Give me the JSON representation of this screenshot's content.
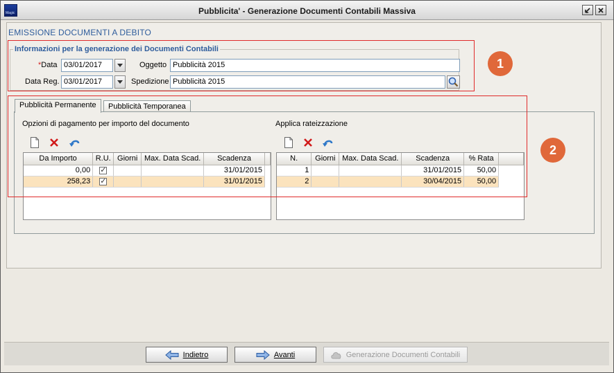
{
  "window": {
    "title": "Pubblicita' - Generazione Documenti Contabili Massiva",
    "icon_name": "app-logo-icon",
    "icon_caption": "Magic"
  },
  "section": {
    "title": "EMISSIONE DOCUMENTI A DEBITO"
  },
  "info": {
    "legend": "Informazioni per la generazione dei Documenti Contabili",
    "data_required_mark": "*",
    "data_label": "Data",
    "data_value": "03/01/2017",
    "data_reg_label": "Data Reg.",
    "data_reg_value": "03/01/2017",
    "oggetto_label": "Oggetto",
    "oggetto_value": "Pubblicità 2015",
    "spedizione_label": "Spedizione",
    "spedizione_value": "Pubblicità 2015"
  },
  "tabs": [
    {
      "label": "Pubblicità Permanente",
      "active": true
    },
    {
      "label": "Pubblicità Temporanea",
      "active": false
    }
  ],
  "left_grid": {
    "label": "Opzioni di pagamento per importo del documento",
    "columns": [
      "Da Importo",
      "R.U.",
      "Giorni",
      "Max. Data Scad.",
      "Scadenza"
    ],
    "rows": [
      {
        "da_importo": "0,00",
        "ru": true,
        "giorni": "",
        "max_data": "",
        "scadenza": "31/01/2015"
      },
      {
        "da_importo": "258,23",
        "ru": true,
        "giorni": "",
        "max_data": "",
        "scadenza": "31/01/2015"
      }
    ]
  },
  "right_grid": {
    "label": "Applica rateizzazione",
    "columns": [
      "N.",
      "Giorni",
      "Max. Data Scad.",
      "Scadenza",
      "% Rata"
    ],
    "rows": [
      {
        "n": "1",
        "giorni": "",
        "max_data": "",
        "scadenza": "31/01/2015",
        "rata": "50,00"
      },
      {
        "n": "2",
        "giorni": "",
        "max_data": "",
        "scadenza": "30/04/2015",
        "rata": "50,00"
      }
    ]
  },
  "annotations": {
    "badge1": "1",
    "badge2": "2",
    "box_color": "#e02a2a",
    "badge_color": "#e0683a"
  },
  "buttons": {
    "indietro": "Indietro",
    "avanti": "Avanti",
    "generazione": "Generazione Documenti Contabili"
  },
  "colors": {
    "section_title": "#2f5d9c",
    "selected_row": "#fbe3bd"
  }
}
